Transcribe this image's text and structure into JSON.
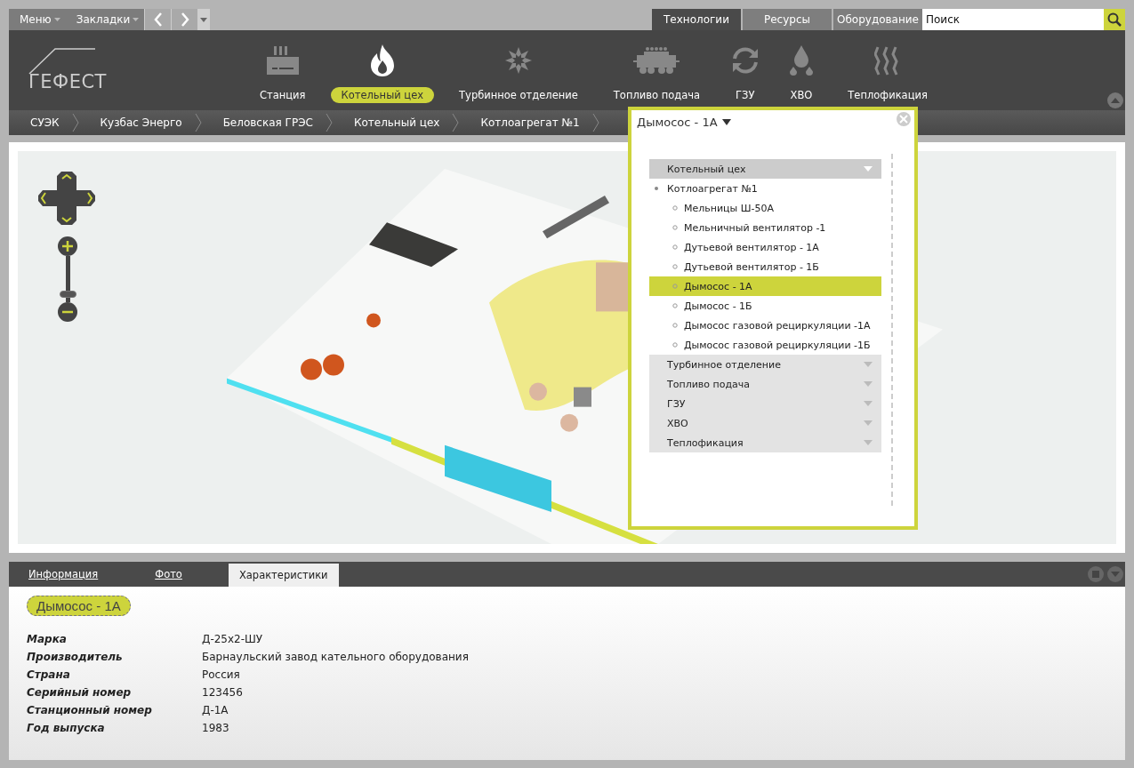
{
  "top_menu": [
    {
      "label": "Меню"
    },
    {
      "label": "Закладки"
    }
  ],
  "view_tabs": [
    {
      "label": "Технологии",
      "selected": true
    },
    {
      "label": "Ресурсы",
      "selected": false
    },
    {
      "label": "Оборудование",
      "selected": false
    }
  ],
  "search": {
    "placeholder": "Поиск"
  },
  "logo": {
    "text": "ГЕФЕСТ"
  },
  "sections": [
    {
      "label": "Станция",
      "kind": "station",
      "selected": false
    },
    {
      "label": "Котельный цех",
      "kind": "flame",
      "selected": true
    },
    {
      "label": "Турбинное отделение",
      "kind": "turbine",
      "selected": false
    },
    {
      "label": "Топливо подача",
      "kind": "wagon",
      "selected": false
    },
    {
      "label": "ГЗУ",
      "kind": "cycle",
      "selected": false
    },
    {
      "label": "ХВО",
      "kind": "drops",
      "selected": false
    },
    {
      "label": "Теплофикация",
      "kind": "heat",
      "selected": false
    }
  ],
  "breadcrumbs": [
    "СУЭК",
    "Кузбас Энерго",
    "Беловская ГРЭС",
    "Котельный цех",
    "Котлоагрегат №1"
  ],
  "map": {
    "zoom": {
      "level": 0.1
    }
  },
  "popup": {
    "title": "Дымосос - 1А",
    "tree": [
      {
        "label": "Котельный цех",
        "expanded": true,
        "children": [
          {
            "label": "Котлоагрегат №1",
            "selected": false,
            "children": [
              {
                "label": "Мельницы Ш-50А",
                "selected": false
              },
              {
                "label": "Мельничный вентилятор -1",
                "selected": false
              },
              {
                "label": "Дутьевой вентилятор - 1А",
                "selected": false
              },
              {
                "label": "Дутьевой вентилятор - 1Б",
                "selected": false
              },
              {
                "label": "Дымосос - 1А",
                "selected": true
              },
              {
                "label": "Дымосос - 1Б",
                "selected": false
              },
              {
                "label": "Дымосос газовой рециркуляции -1А",
                "selected": false
              },
              {
                "label": "Дымосос газовой рециркуляции -1Б",
                "selected": false
              }
            ]
          }
        ]
      },
      {
        "label": "Турбинное отделение",
        "expanded": false
      },
      {
        "label": "Топливо подача",
        "expanded": false
      },
      {
        "label": "ГЗУ",
        "expanded": false
      },
      {
        "label": "ХВО",
        "expanded": false
      },
      {
        "label": "Теплофикация",
        "expanded": false
      }
    ]
  },
  "details": {
    "tabs": [
      {
        "label": "Информация",
        "selected": false
      },
      {
        "label": "Фото",
        "selected": false
      },
      {
        "label": "Характеристики",
        "selected": true
      }
    ],
    "badge": "Дымосос - 1А",
    "properties": [
      {
        "name": "Марка",
        "value": "Д-25х2-ШУ"
      },
      {
        "name": "Производитель",
        "value": "Барнаульский завод кательного оборудования"
      },
      {
        "name": "Страна",
        "value": "Россия"
      },
      {
        "name": "Серийный номер",
        "value": "123456"
      },
      {
        "name": "Станционный номер",
        "value": "Д-1А"
      },
      {
        "name": "Год выпуска",
        "value": "1983"
      }
    ]
  }
}
